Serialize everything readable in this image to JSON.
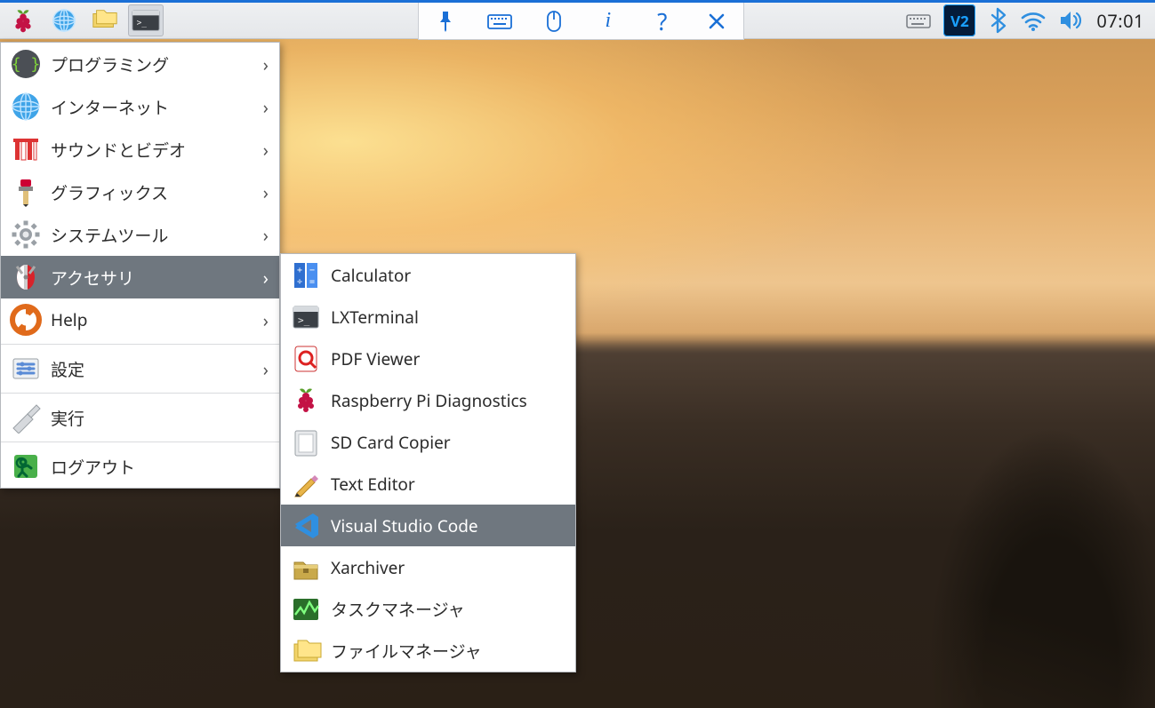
{
  "taskbar": {
    "clock": "07:01",
    "vnc_label": "V2"
  },
  "center_toolbar": {
    "icons": [
      "pin",
      "keyboard",
      "mouse",
      "info",
      "help",
      "close"
    ]
  },
  "menu": {
    "items": [
      {
        "id": "programming",
        "label": "プログラミング",
        "sub": true
      },
      {
        "id": "internet",
        "label": "インターネット",
        "sub": true
      },
      {
        "id": "soundvideo",
        "label": "サウンドとビデオ",
        "sub": true
      },
      {
        "id": "graphics",
        "label": "グラフィックス",
        "sub": true
      },
      {
        "id": "systemtools",
        "label": "システムツール",
        "sub": true
      },
      {
        "id": "accessories",
        "label": "アクセサリ",
        "sub": true,
        "hl": true
      },
      {
        "id": "help",
        "label": "Help",
        "sub": true
      },
      {
        "id": "preferences",
        "label": "設定",
        "sub": true,
        "sep_before": true
      },
      {
        "id": "run",
        "label": "実行",
        "sub": false,
        "sep_before": true
      },
      {
        "id": "logout",
        "label": "ログアウト",
        "sub": false,
        "sep_before": true
      }
    ]
  },
  "submenu": {
    "items": [
      {
        "id": "calculator",
        "label": "Calculator"
      },
      {
        "id": "lxterminal",
        "label": "LXTerminal"
      },
      {
        "id": "pdfviewer",
        "label": "PDF Viewer"
      },
      {
        "id": "rpidiag",
        "label": "Raspberry Pi Diagnostics"
      },
      {
        "id": "sdcopier",
        "label": "SD Card Copier"
      },
      {
        "id": "texteditor",
        "label": "Text Editor"
      },
      {
        "id": "vscode",
        "label": "Visual Studio Code",
        "hl": true
      },
      {
        "id": "xarchiver",
        "label": "Xarchiver"
      },
      {
        "id": "taskmgr",
        "label": "タスクマネージャ"
      },
      {
        "id": "filemgr",
        "label": "ファイルマネージャ"
      }
    ]
  }
}
